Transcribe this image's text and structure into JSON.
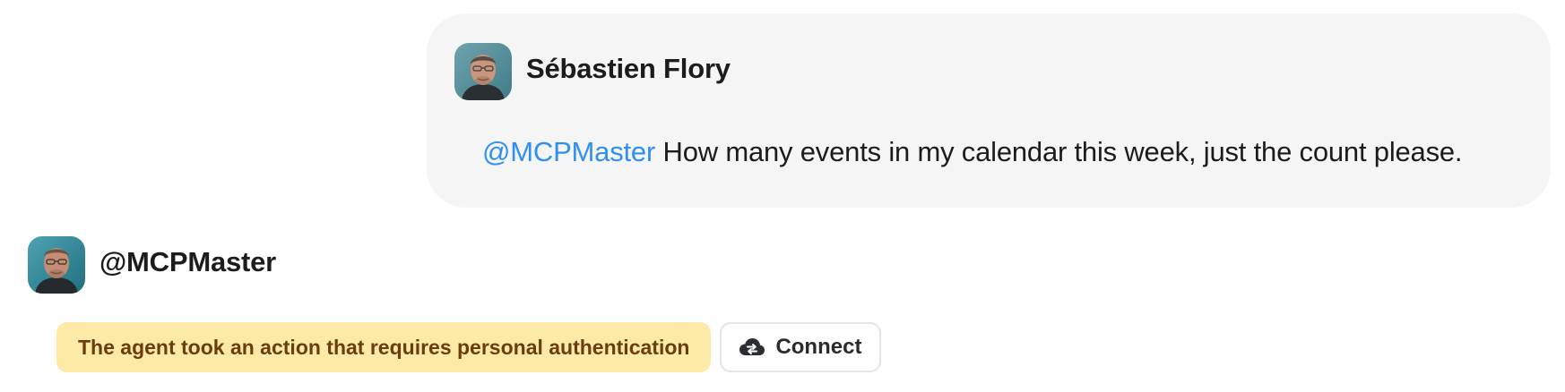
{
  "user_message": {
    "author": "Sébastien Flory",
    "mention": "@MCPMaster",
    "text": " How many events in my calendar this week, just the count please."
  },
  "agent_message": {
    "author": "@MCPMaster",
    "auth_notice": "The agent took an action that requires personal authentication",
    "connect_label": "Connect"
  },
  "colors": {
    "mention": "#2f8ff2",
    "bubble_bg": "#f5f5f5",
    "notice_bg": "#fdeaa6",
    "notice_text": "#6b3d0e"
  },
  "icons": {
    "user_avatar": "person-photo",
    "agent_avatar": "person-photo",
    "connect": "cloud-sync-icon"
  }
}
